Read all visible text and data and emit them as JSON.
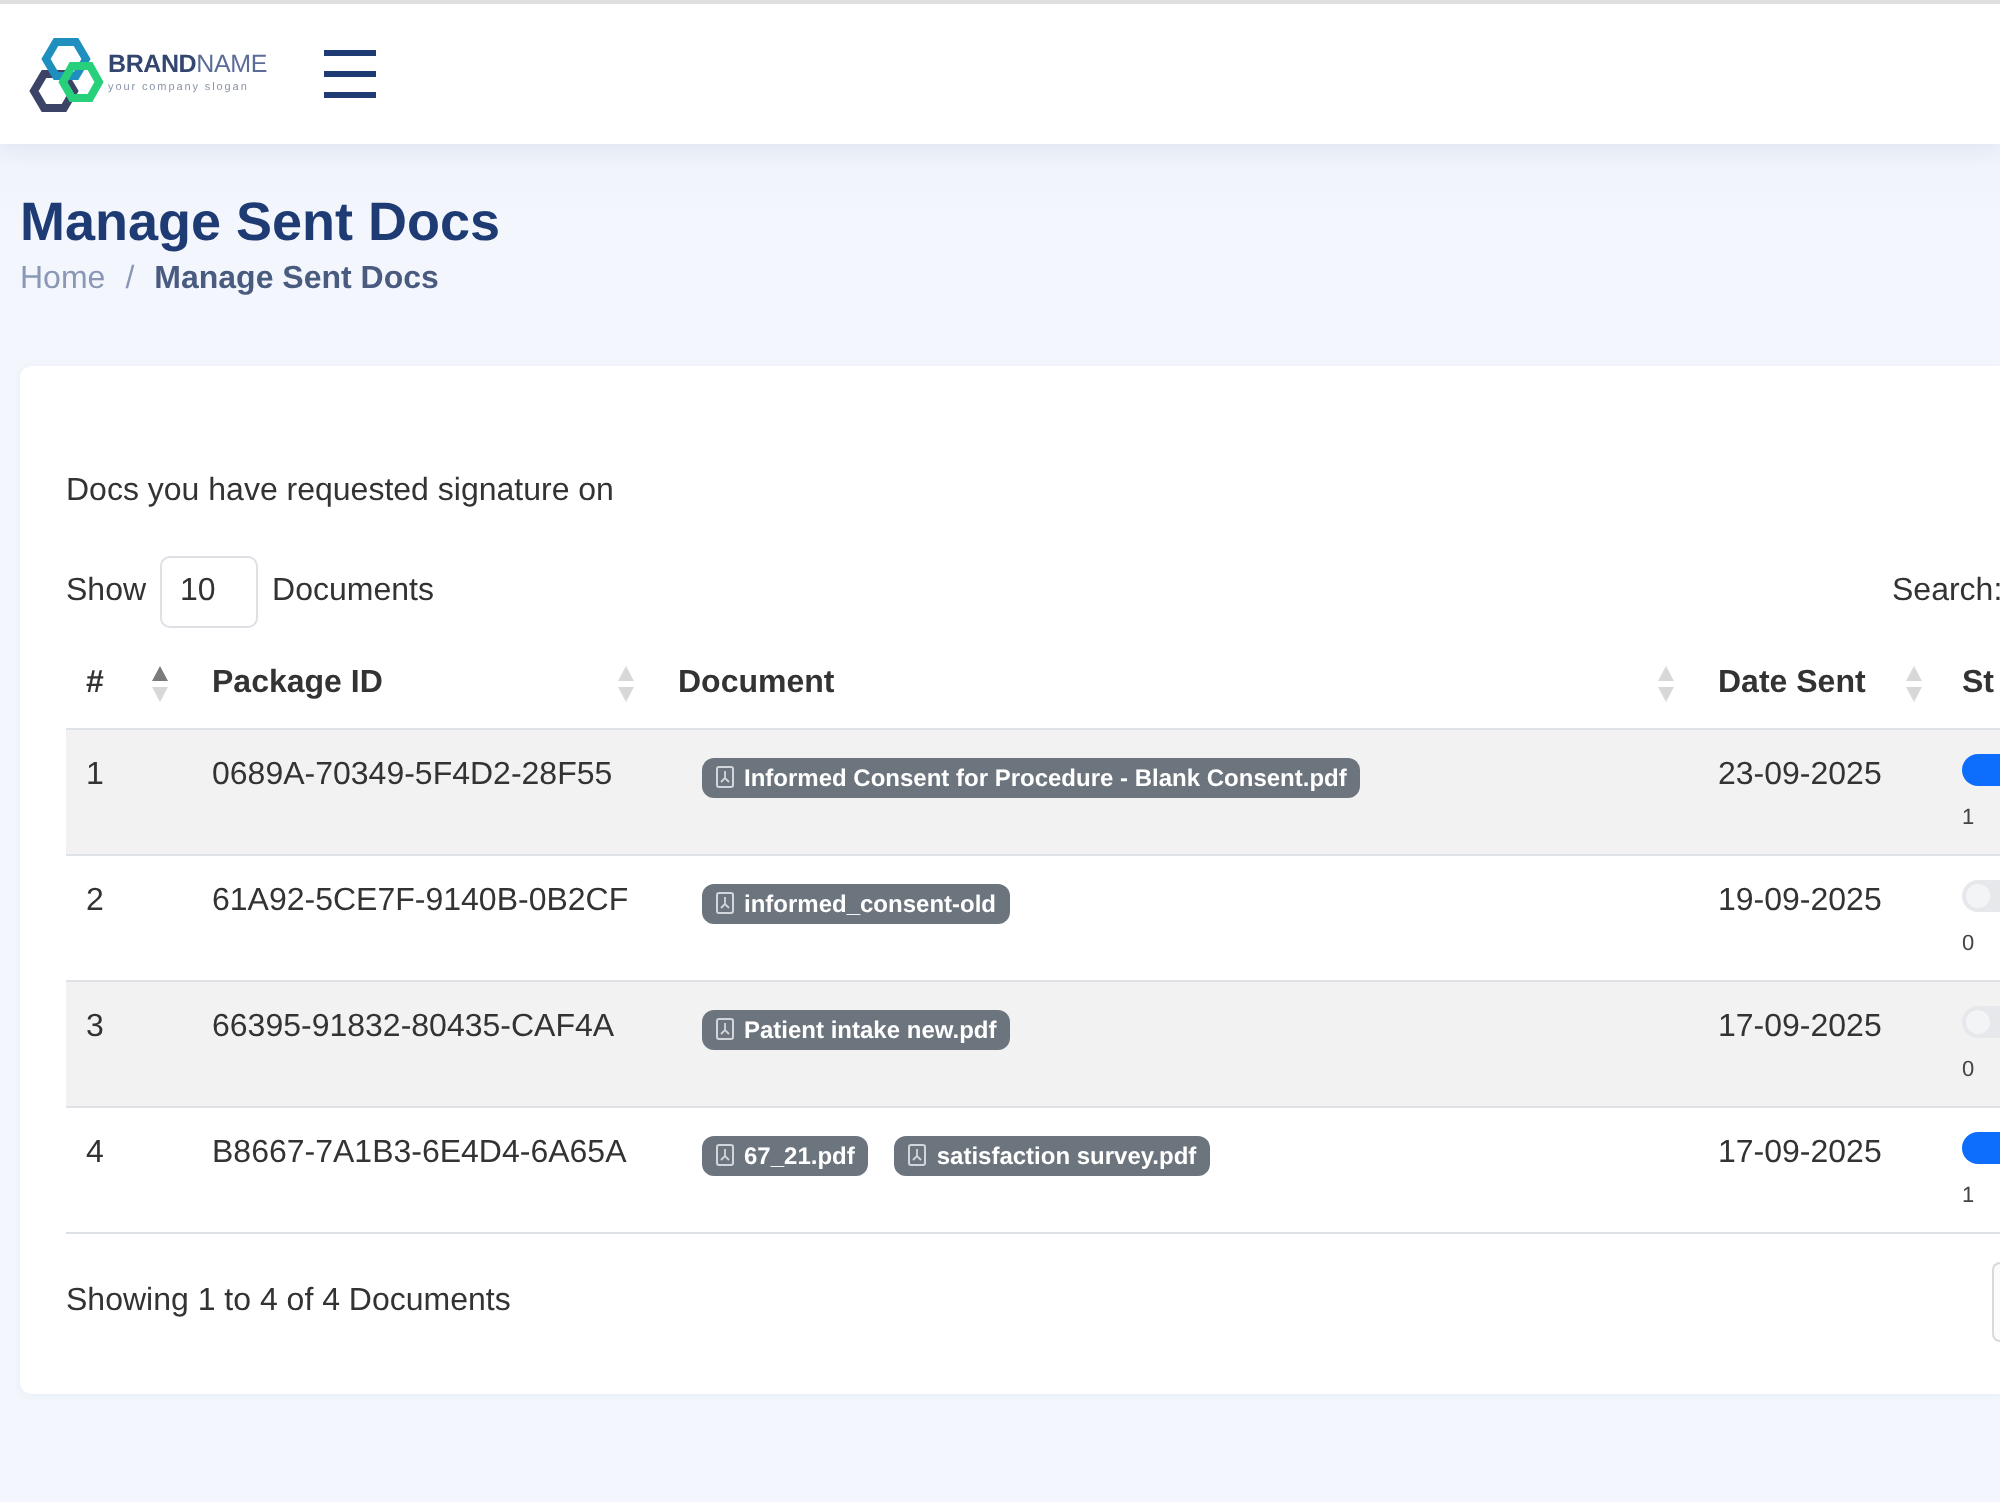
{
  "header": {
    "brand": {
      "name": "**BRAND**NAME",
      "slogan": "your company slogan"
    }
  },
  "page": {
    "title": "Manage Sent Docs",
    "breadcrumb": {
      "items": [
        {
          "label": "Home",
          "active": false
        },
        {
          "label": "Manage Sent Docs",
          "active": true
        }
      ],
      "separator": "/"
    }
  },
  "card": {
    "intro": "Docs you have requested signature on",
    "page_size": {
      "label_before": "Show",
      "value": "10",
      "label_after": "Documents"
    },
    "search_label": "Search:",
    "table": {
      "columns": [
        {
          "label": "#",
          "sorted": true
        },
        {
          "label": "Package ID",
          "sorted": false
        },
        {
          "label": "Document",
          "sorted": false
        },
        {
          "label": "Date Sent",
          "sorted": false
        },
        {
          "label": "St"
        }
      ],
      "rows": [
        {
          "number": "1",
          "package_id": "0689A-70349-5F4D2-28F55",
          "documents": [
            "Informed Consent for Procedure - Blank Consent.pdf"
          ],
          "date_sent": "23-09-2025",
          "switch_on": true,
          "switch_text": "1"
        },
        {
          "number": "2",
          "package_id": "61A92-5CE7F-9140B-0B2CF",
          "documents": [
            "informed_consent-old"
          ],
          "date_sent": "19-09-2025",
          "switch_on": false,
          "switch_text": "0"
        },
        {
          "number": "3",
          "package_id": "66395-91832-80435-CAF4A",
          "documents": [
            "Patient intake new.pdf"
          ],
          "date_sent": "17-09-2025",
          "switch_on": false,
          "switch_text": "0"
        },
        {
          "number": "4",
          "package_id": "B8667-7A1B3-6E4D4-6A65A",
          "documents": [
            "67_21.pdf",
            "satisfaction survey.pdf"
          ],
          "date_sent": "17-09-2025",
          "switch_on": true,
          "switch_text": "1"
        }
      ]
    },
    "info": "Showing 1 to 4 of 4 Documents"
  }
}
